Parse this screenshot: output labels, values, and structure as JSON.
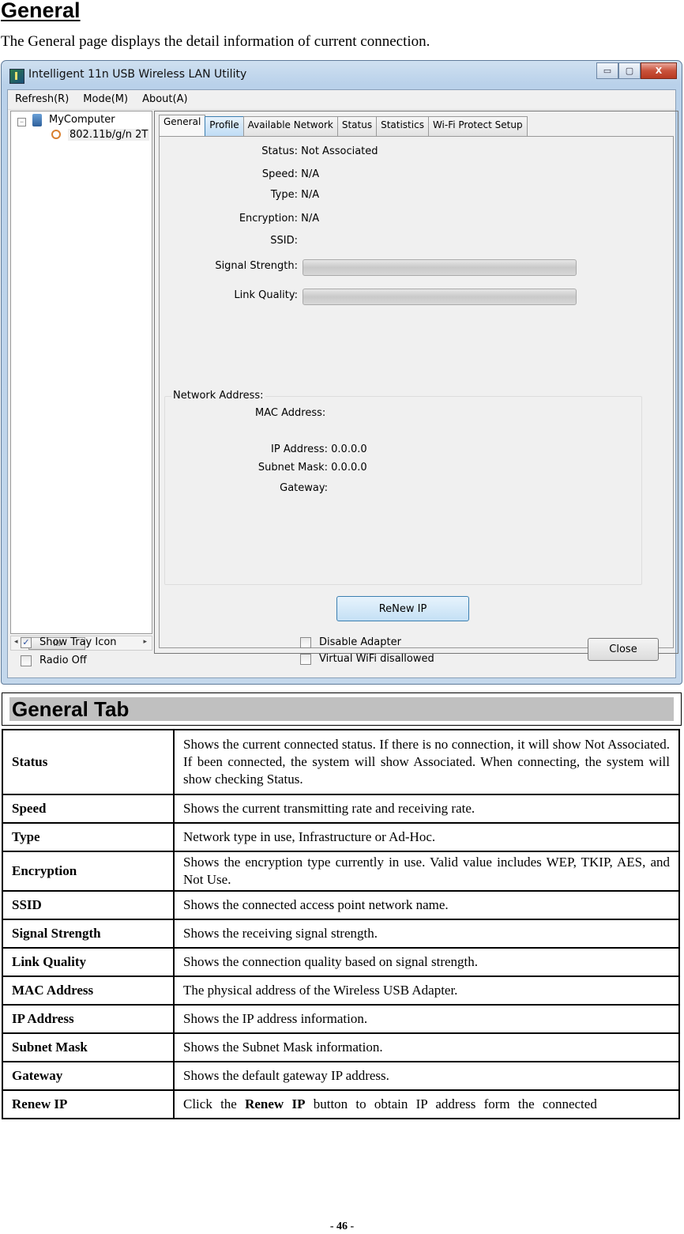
{
  "doc": {
    "section_title": "General",
    "intro": "The General page displays the detail information of current connection.",
    "page_number": "- 46 -"
  },
  "window": {
    "title": "Intelligent 11n USB Wireless LAN Utility",
    "controls": {
      "minimize": "▭",
      "maximize": "▢",
      "close": "X"
    },
    "menu": [
      "Refresh(R)",
      "Mode(M)",
      "About(A)"
    ],
    "tree": {
      "root": "MyComputer",
      "child": "802.11b/g/n 2T"
    },
    "scroll_thumb": "III",
    "tabs": [
      "General",
      "Profile",
      "Available Network",
      "Status",
      "Statistics",
      "Wi-Fi Protect Setup"
    ],
    "active_tab": "General",
    "fields": {
      "status": {
        "label": "Status:",
        "value": "Not Associated"
      },
      "speed": {
        "label": "Speed:",
        "value": "N/A"
      },
      "type": {
        "label": "Type:",
        "value": "N/A"
      },
      "encryption": {
        "label": "Encryption:",
        "value": "N/A"
      },
      "ssid": {
        "label": "SSID:",
        "value": ""
      },
      "signal_strength": {
        "label": "Signal Strength:",
        "percent": 0
      },
      "link_quality": {
        "label": "Link Quality:",
        "percent": 0
      }
    },
    "network_address": {
      "title": "Network Address:",
      "mac": {
        "label": "MAC Address:",
        "value": ""
      },
      "ip": {
        "label": "IP Address:",
        "value": "0.0.0.0"
      },
      "subnet": {
        "label": "Subnet Mask:",
        "value": "0.0.0.0"
      },
      "gateway": {
        "label": "Gateway:",
        "value": ""
      }
    },
    "renew_button": "ReNew IP",
    "checkboxes": {
      "show_tray_icon": {
        "label": "Show Tray Icon",
        "checked": true
      },
      "radio_off": {
        "label": "Radio Off",
        "checked": false
      },
      "disable_adapter": {
        "label": "Disable Adapter",
        "checked": false
      },
      "virtual_wifi": {
        "label": "Virtual WiFi disallowed",
        "checked": false
      }
    },
    "close_button": "Close"
  },
  "table": {
    "title": "General Tab",
    "rows": [
      {
        "key": "Status",
        "value": "Shows the current connected status. If there is no connection, it will show Not Associated. If been connected, the system will show Associated. When connecting, the system will show checking Status."
      },
      {
        "key": "Speed",
        "value": "Shows the current transmitting rate and receiving rate."
      },
      {
        "key": "Type",
        "value": "Network type in use, Infrastructure or Ad-Hoc."
      },
      {
        "key": "Encryption",
        "value": "Shows the encryption type currently in use. Valid value includes WEP, TKIP, AES, and Not Use."
      },
      {
        "key": "SSID",
        "value": "Shows the connected access point network name."
      },
      {
        "key": "Signal Strength",
        "value": "Shows the receiving signal strength."
      },
      {
        "key": "Link Quality",
        "value": "Shows the connection quality based on signal strength."
      },
      {
        "key": "MAC Address",
        "value": "The physical address of the Wireless USB Adapter."
      },
      {
        "key": "IP Address",
        "value": "Shows the IP address information."
      },
      {
        "key": "Subnet Mask",
        "value": "Shows the Subnet Mask information."
      },
      {
        "key": "Gateway",
        "value": "Shows the default gateway IP address."
      },
      {
        "key": "Renew IP",
        "value_parts": [
          "Click the ",
          "Renew IP",
          " button to obtain IP address form the connected"
        ]
      }
    ]
  }
}
